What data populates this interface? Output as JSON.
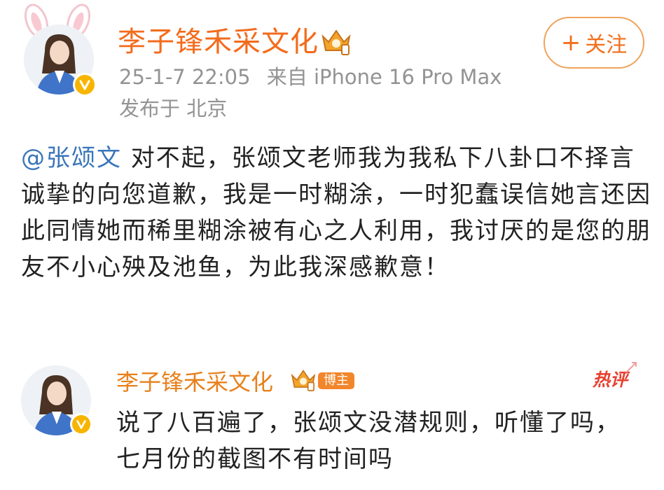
{
  "post": {
    "author": "李子锋禾采文化",
    "timestamp": "25-1-7 22:05",
    "source": "来自 iPhone 16 Pro Max",
    "location": "发布于 北京",
    "follow_label": "关注",
    "mention": "@张颂文",
    "body": " 对不起，张颂文老师我为我私下八卦口不择言诚挚的向您道歉，我是一时糊涂，一时犯蠢误信她言还因此同情她而稀里糊涂被有心之人利用，我讨厌的是您的朋友不小心殃及池鱼，为此我深感歉意！"
  },
  "comment": {
    "author": "李子锋禾采文化",
    "badge_label": "博主",
    "hot_label": "热评",
    "text": "说了八百遍了，张颂文没潜规则，听懂了吗，七月份的截图不有时间吗"
  },
  "colors": {
    "name_orange": "#f36b1c",
    "mention_blue": "#3a76b9",
    "verified_gold": "#f7b500",
    "hot_red": "#e8402f"
  },
  "icons": {
    "verified": "verified-v-icon",
    "rank": "crown-rank-icon",
    "avatar_ears": "bunny-ears-icon"
  }
}
